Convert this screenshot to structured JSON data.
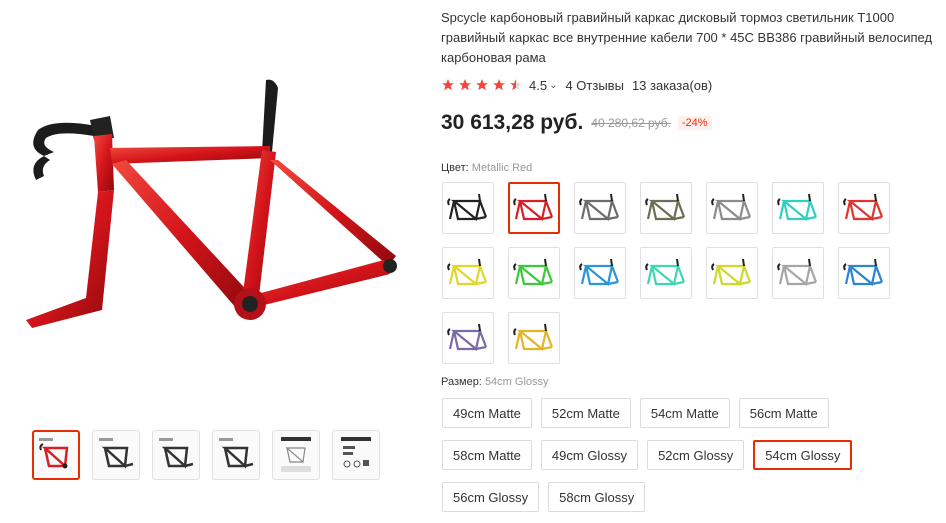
{
  "product": {
    "title": "Spcycle карбоновый гравийный каркас дисковый тормоз светильник T1000 гравийный каркас все внутренние кабели 700 * 45C BB386 гравийный велосипед карбоновая рама",
    "rating": "4.5",
    "rating_stars": 4.5,
    "reviews": "4 Отзывы",
    "orders": "13 заказа(ов)",
    "price": "30 613,28 руб.",
    "old_price": "40 280,62 руб.",
    "discount": "-24%"
  },
  "colors": {
    "label": "Цвет:",
    "selected": "Metallic Red",
    "swatches": [
      {
        "name": "black",
        "color": "#222222"
      },
      {
        "name": "metallic-red",
        "color": "#d81f26"
      },
      {
        "name": "gray",
        "color": "#6d6d6d"
      },
      {
        "name": "olive",
        "color": "#6b6f52"
      },
      {
        "name": "silver",
        "color": "#8c8c8c"
      },
      {
        "name": "turquoise",
        "color": "#2fcfc3"
      },
      {
        "name": "red",
        "color": "#e0342e"
      },
      {
        "name": "yellow",
        "color": "#e3d62a"
      },
      {
        "name": "green",
        "color": "#3cc83a"
      },
      {
        "name": "blue",
        "color": "#2b95d8"
      },
      {
        "name": "mint",
        "color": "#3fd6b6"
      },
      {
        "name": "lime",
        "color": "#cfd82a"
      },
      {
        "name": "light-gray",
        "color": "#a6a6a6"
      },
      {
        "name": "sky-blue",
        "color": "#2c84d4"
      },
      {
        "name": "purple",
        "color": "#7a6ba6"
      },
      {
        "name": "gold",
        "color": "#e2b527"
      }
    ],
    "selected_index": 1
  },
  "sizes": {
    "label": "Размер:",
    "selected": "54cm Glossy",
    "options": [
      "49cm Matte",
      "52cm Matte",
      "54cm Matte",
      "56cm Matte",
      "58cm Matte",
      "49cm Glossy",
      "52cm Glossy",
      "54cm Glossy",
      "56cm Glossy",
      "58cm Glossy"
    ],
    "selected_index": 7
  },
  "gallery": {
    "thumbnails": [
      {
        "name": "red-frame-thumb",
        "color": "#d81f26",
        "type": "frame"
      },
      {
        "name": "black-frame-thumb-1",
        "color": "#333333",
        "type": "frame"
      },
      {
        "name": "black-frame-thumb-2",
        "color": "#333333",
        "type": "frame"
      },
      {
        "name": "black-frame-thumb-3",
        "color": "#333333",
        "type": "frame"
      },
      {
        "name": "geometry-sheet-thumb",
        "color": "#555555",
        "type": "doc"
      },
      {
        "name": "accessories-sheet-thumb",
        "color": "#555555",
        "type": "doc"
      }
    ],
    "selected_index": 0
  }
}
